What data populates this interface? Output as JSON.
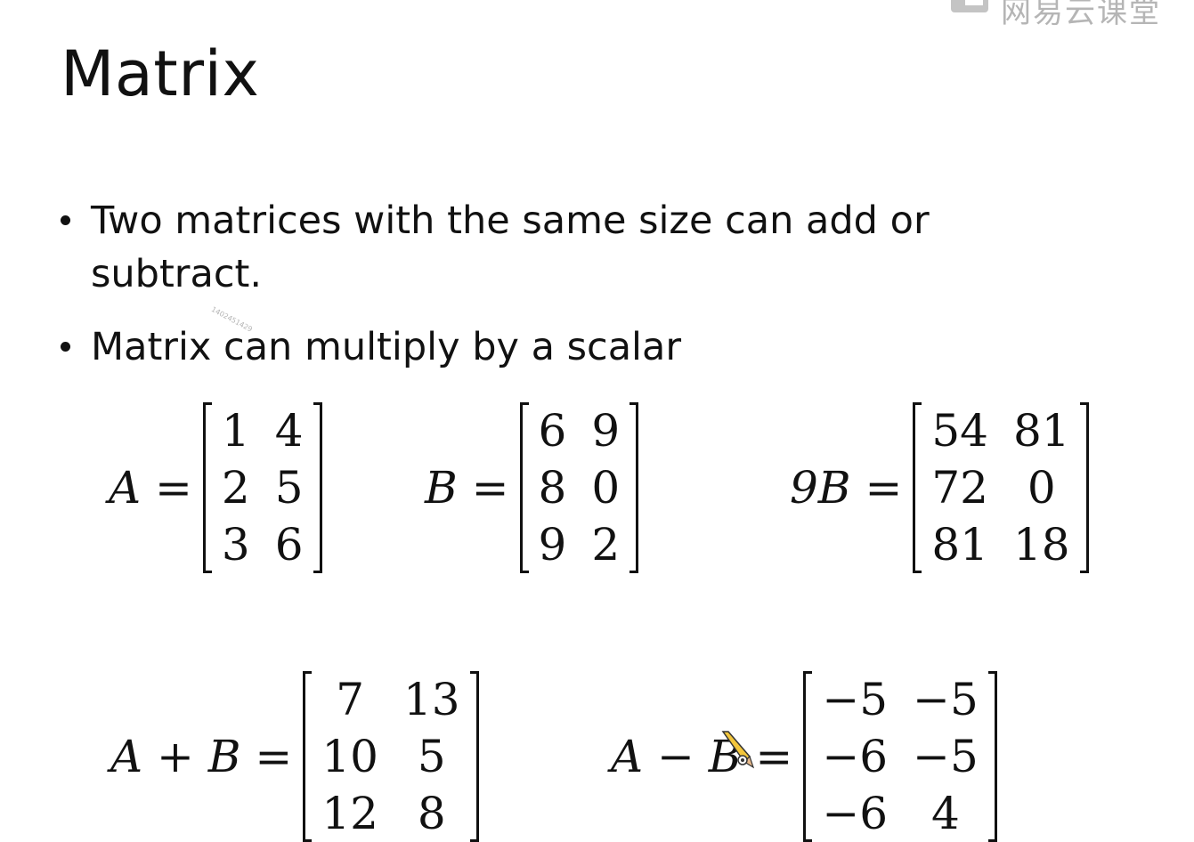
{
  "watermark": {
    "text": "网易云课堂"
  },
  "slide": {
    "title": "Matrix",
    "bullets": [
      "Two matrices with the same size can add or subtract.",
      "Matrix can multiply by a scalar"
    ],
    "stamp": "1402451429"
  },
  "equations": {
    "A": {
      "lhs": "A =",
      "rows": [
        [
          "1",
          "4"
        ],
        [
          "2",
          "5"
        ],
        [
          "3",
          "6"
        ]
      ]
    },
    "B": {
      "lhs": "B =",
      "rows": [
        [
          "6",
          "9"
        ],
        [
          "8",
          "0"
        ],
        [
          "9",
          "2"
        ]
      ]
    },
    "nineB": {
      "lhs": "9B =",
      "rows": [
        [
          "54",
          "81"
        ],
        [
          "72",
          "0"
        ],
        [
          "81",
          "18"
        ]
      ]
    },
    "sum": {
      "lhs": "A + B =",
      "rows": [
        [
          "7",
          "13"
        ],
        [
          "10",
          "5"
        ],
        [
          "12",
          "8"
        ]
      ]
    },
    "diff": {
      "lhs": "A − B =",
      "rows": [
        [
          "−5",
          "−5"
        ],
        [
          "−6",
          "−5"
        ],
        [
          "−6",
          "4"
        ]
      ]
    }
  },
  "cursor": {
    "icon": "pencil-cursor-icon"
  }
}
